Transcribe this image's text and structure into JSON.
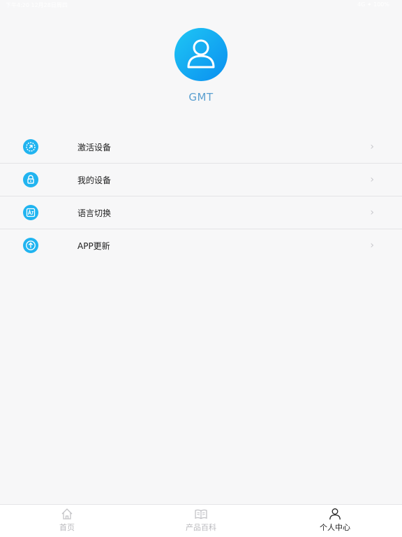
{
  "status_bar": {
    "left": "下午4:20  12月28日周四",
    "right": "4G ✦ 100%"
  },
  "profile": {
    "username": "GMT"
  },
  "menu": [
    {
      "label": "激活设备",
      "icon": "activate-icon"
    },
    {
      "label": "我的设备",
      "icon": "lock-icon"
    },
    {
      "label": "语言切换",
      "icon": "translate-icon"
    },
    {
      "label": "APP更新",
      "icon": "upload-icon"
    }
  ],
  "tabs": [
    {
      "label": "首页",
      "icon": "home-icon",
      "active": false
    },
    {
      "label": "产品百科",
      "icon": "book-icon",
      "active": false
    },
    {
      "label": "个人中心",
      "icon": "person-icon",
      "active": true
    }
  ],
  "colors": {
    "accent": "#21b4f0",
    "username": "#5a9fd0",
    "background": "#f7f7f8"
  }
}
